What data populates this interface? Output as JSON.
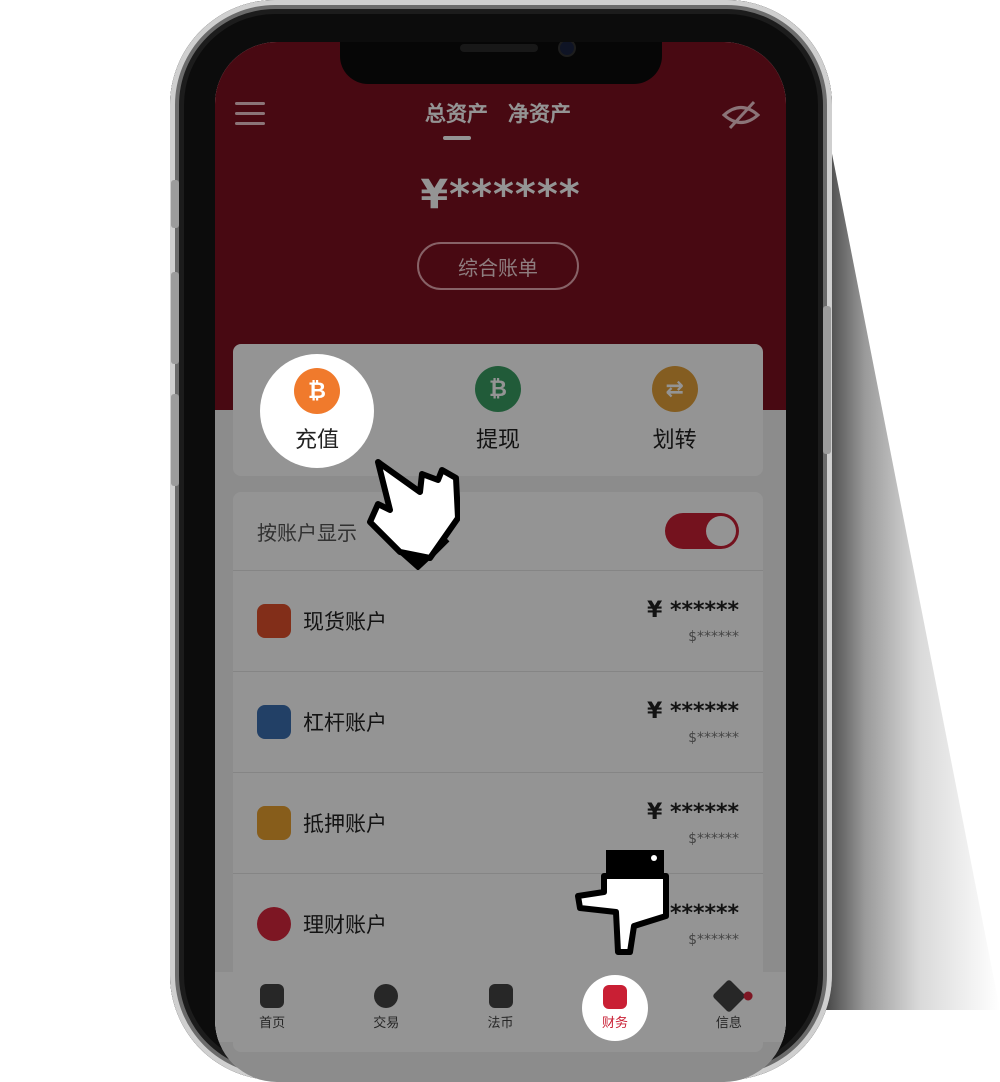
{
  "header": {
    "tabs": [
      {
        "label": "总资产",
        "active": true
      },
      {
        "label": "净资产",
        "active": false
      }
    ],
    "balance": "¥******",
    "bill_button": "综合账单",
    "icons": {
      "menu": "menu-icon",
      "visibility": "eye-off-icon"
    },
    "color": "#7c111f"
  },
  "actions": [
    {
      "label": "充值",
      "icon": "bitcoin-deposit-icon",
      "color": "#f07a2c",
      "glyph": "₿"
    },
    {
      "label": "提现",
      "icon": "bitcoin-withdraw-icon",
      "color": "#3a9e63",
      "glyph": "₿"
    },
    {
      "label": "划转",
      "icon": "transfer-icon",
      "color": "#e3a13a",
      "glyph": "⇄"
    }
  ],
  "account_toggle": {
    "label": "按账户显示",
    "on": true
  },
  "accounts": [
    {
      "name": "现货账户",
      "cny": "¥ ******",
      "usd": "$******",
      "icon": "coin-stack-icon",
      "color": "#e0502c"
    },
    {
      "name": "杠杆账户",
      "cny": "¥ ******",
      "usd": "$******",
      "icon": "leverage-icon",
      "color": "#3c6fb0"
    },
    {
      "name": "抵押账户",
      "cny": "¥ ******",
      "usd": "$******",
      "icon": "collateral-icon",
      "color": "#e8a030"
    },
    {
      "name": "理财账户",
      "cny": "¥ ******",
      "usd": "$******",
      "icon": "piggy-bank-icon",
      "color": "#d7263d"
    }
  ],
  "tabbar": [
    {
      "label": "首页",
      "icon": "home-icon",
      "active": false
    },
    {
      "label": "交易",
      "icon": "trade-icon",
      "active": false
    },
    {
      "label": "法币",
      "icon": "fiat-icon",
      "active": false
    },
    {
      "label": "财务",
      "icon": "finance-icon",
      "active": true
    },
    {
      "label": "信息",
      "icon": "message-icon",
      "active": false,
      "badge": true
    }
  ],
  "accent_color": "#c91f34"
}
